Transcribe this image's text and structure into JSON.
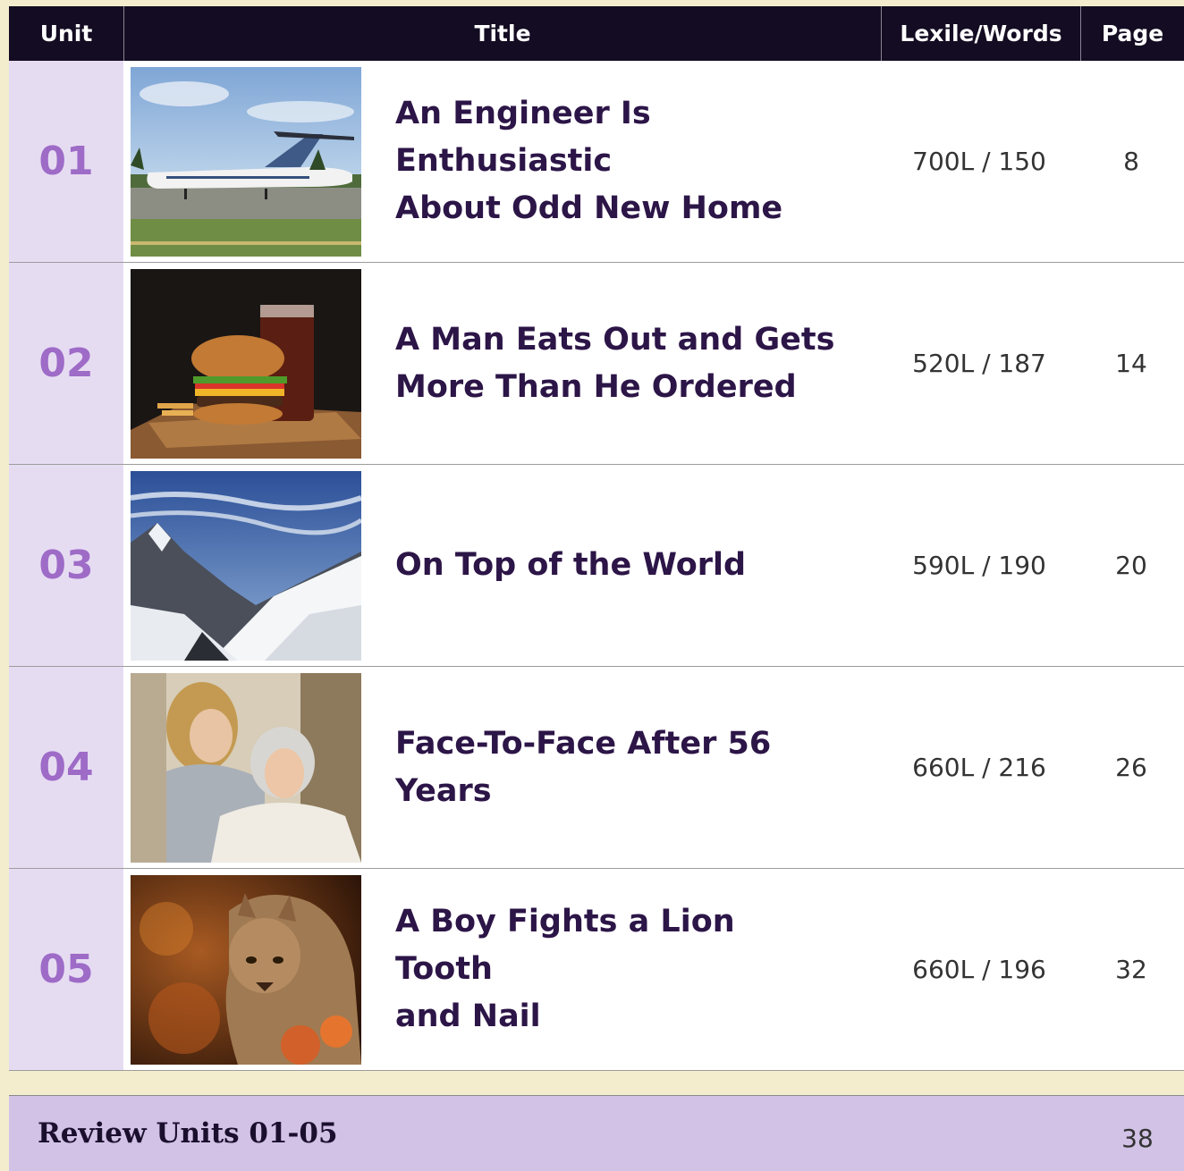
{
  "header": {
    "unit": "Unit",
    "title": "Title",
    "lexile_words": "Lexile/Words",
    "page": "Page"
  },
  "rows": [
    {
      "unit": "01",
      "title_line1": "An Engineer Is Enthusiastic",
      "title_line2": "About Odd New Home",
      "lexile": "700L / 150",
      "page": "8",
      "image": "airplane-photo"
    },
    {
      "unit": "02",
      "title_line1": "A Man Eats Out and Gets",
      "title_line2": "More Than He Ordered",
      "lexile": "520L / 187",
      "page": "14",
      "image": "burger-photo"
    },
    {
      "unit": "03",
      "title_line1": "On Top of the World",
      "title_line2": "",
      "lexile": "590L / 190",
      "page": "20",
      "image": "mountain-photo"
    },
    {
      "unit": "04",
      "title_line1": "Face-To-Face After 56 Years",
      "title_line2": "",
      "lexile": "660L / 216",
      "page": "26",
      "image": "women-photo"
    },
    {
      "unit": "05",
      "title_line1": "A Boy Fights a Lion Tooth",
      "title_line2": "and Nail",
      "lexile": "660L / 196",
      "page": "32",
      "image": "cougar-photo"
    }
  ],
  "review": {
    "label": "Review Units 01-05",
    "page": "38"
  },
  "colors": {
    "header_bg": "#140c22",
    "unit_number": "#9e6bc7",
    "unit_cell_bg": "#e6dcf2",
    "title_text": "#2c1547",
    "review_bg": "#d2c2e6"
  }
}
